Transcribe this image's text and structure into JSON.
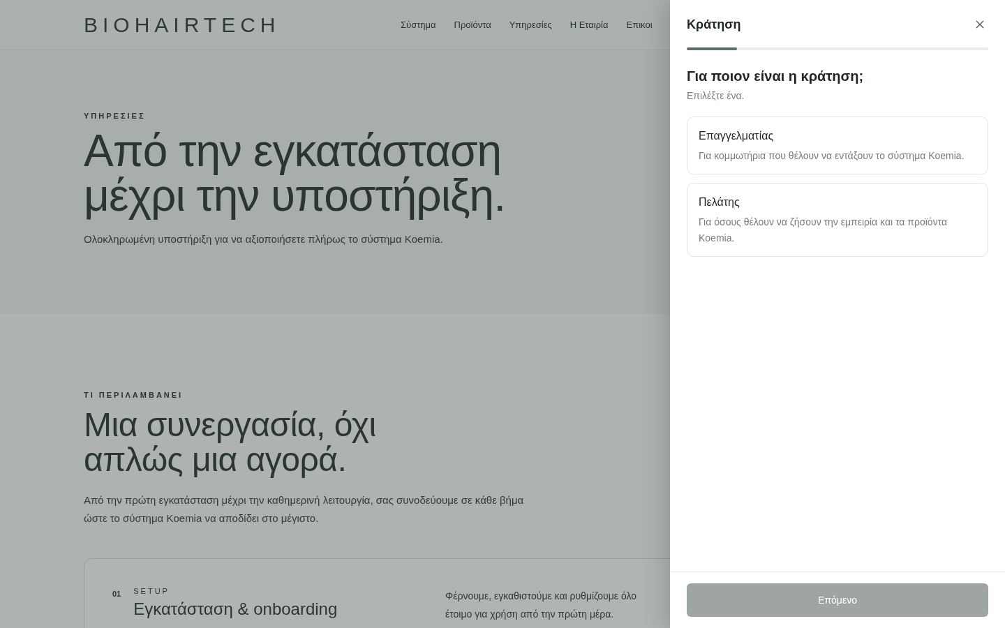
{
  "site": {
    "logo": "BIOHAIRTECH",
    "nav": [
      "Σύστημα",
      "Προϊόντα",
      "Υπηρεσίες",
      "Η Εταιρία",
      "Επικοι"
    ],
    "hero": {
      "eyebrow": "ΥΠΗΡΕΣΙΕΣ",
      "title": "Από την εγκατάσταση μέχρι την υποστήριξη.",
      "subtitle": "Ολοκληρωμένη υποστήριξη για να αξιοποιήσετε πλήρως το σύστημα Koemia."
    },
    "section": {
      "eyebrow": "ΤΙ ΠΕΡΙΛΑΜΒΑΝΕΙ",
      "title": "Μια συνεργασία, όχι απλώς μια αγορά.",
      "text": "Από την πρώτη εγκατάσταση μέχρι την καθημερινή λειτουργία, σας συνοδεύουμε σε κάθε βήμα ώστε το σύστημα Koemia να αποδίδει στο μέγιστο.",
      "card": {
        "number": "01",
        "tag": "SETUP",
        "title": "Εγκατάσταση & onboarding",
        "text_lines": [
          "Φέρνουμε, εγκαθιστούμε και ρυθμίζουμε όλο",
          "έτοιμο για χρήση από την πρώτη μέρα."
        ]
      }
    }
  },
  "panel": {
    "title": "Κράτηση",
    "progress": {
      "level": 0.167
    },
    "question": "Για ποιον είναι η κράτηση;",
    "hint": "Επιλέξτε ένα.",
    "options": [
      {
        "title": "Επαγγελματίας",
        "description": "Για κομμωτήρια που θέλουν να εντάξουν το σύστημα Koemia."
      },
      {
        "title": "Πελάτης",
        "description": "Για όσους θέλουν να ζήσουν την εμπειρία και τα προϊόντα Koemia."
      }
    ],
    "next_button": {
      "label": "Επόμενο",
      "disabled": true
    }
  }
}
